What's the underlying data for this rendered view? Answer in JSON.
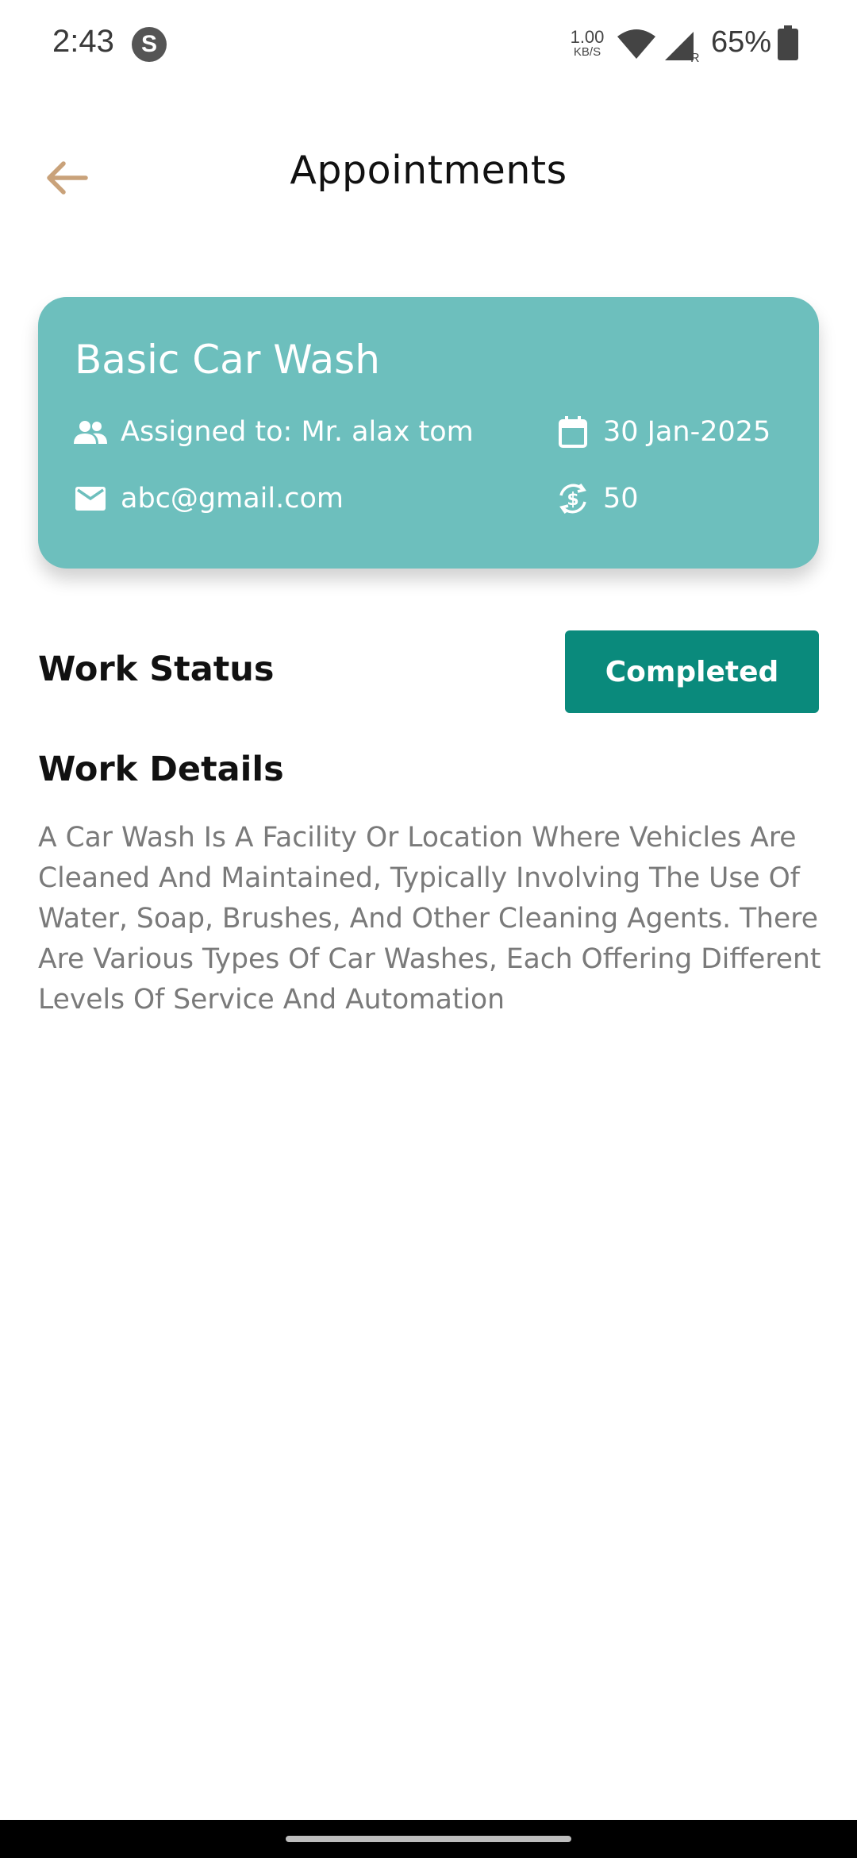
{
  "status_bar": {
    "time": "2:43",
    "app_icon_letter": "S",
    "speed_value": "1.00",
    "speed_unit": "KB/S",
    "signal_badge": "R",
    "battery": "65%"
  },
  "header": {
    "title": "Appointments",
    "back_icon": "arrow-left-icon",
    "accent_color": "#c9a27a"
  },
  "card": {
    "title": "Basic Car Wash",
    "assigned": "Assigned to: Mr. alax tom",
    "date": "30 Jan-2025",
    "email": "abc@gmail.com",
    "price": "50",
    "background_color": "#6dbfbd",
    "icons": {
      "assigned": "people-icon",
      "date": "calendar-icon",
      "email": "mail-icon",
      "price": "currency-exchange-icon"
    }
  },
  "work_status": {
    "label": "Work Status",
    "button": "Completed",
    "button_color": "#0a8a7c"
  },
  "work_details": {
    "label": "Work Details",
    "text": "A Car Wash Is A Facility Or Location Where Vehicles Are Cleaned And Maintained, Typically Involving The Use Of Water, Soap, Brushes, And Other Cleaning Agents. There Are Various Types Of Car Washes, Each Offering Different Levels Of Service And Automation"
  }
}
